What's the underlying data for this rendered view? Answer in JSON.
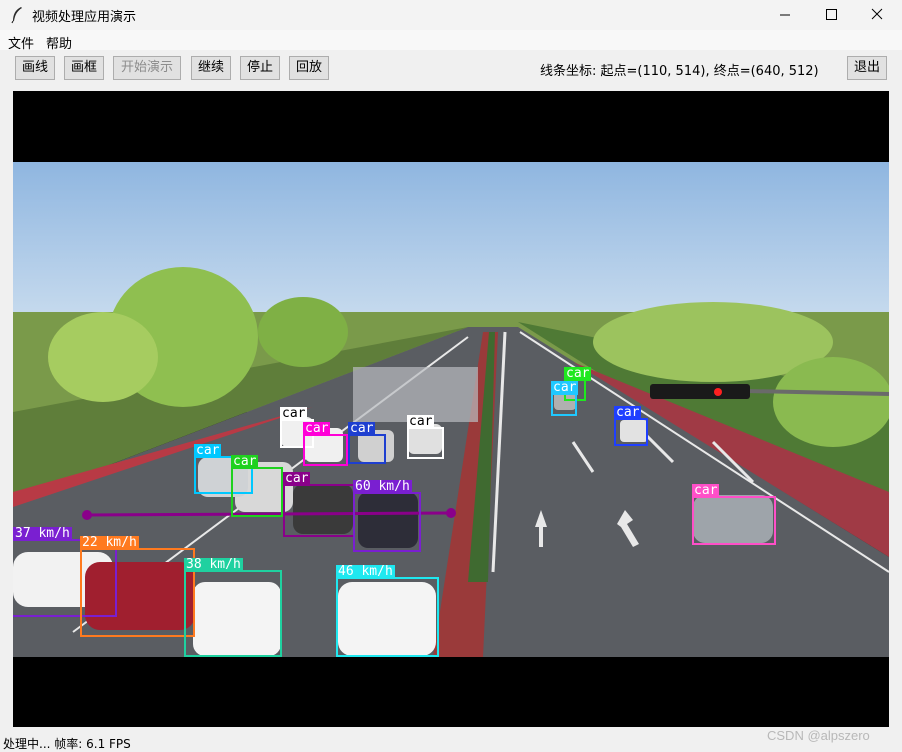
{
  "window": {
    "title": "视频处理应用演示"
  },
  "menu": {
    "file": "文件",
    "help": "帮助"
  },
  "toolbar": {
    "draw_line": "画线",
    "draw_box": "画框",
    "start_demo": "开始演示",
    "continue": "继续",
    "stop": "停止",
    "replay": "回放",
    "line_coords": "线条坐标: 起点=(110, 514), 终点=(640, 512)",
    "exit": "退出"
  },
  "detections": [
    {
      "label": "car",
      "color": "#ffffff"
    },
    {
      "label": "car",
      "color": "#ff00d8"
    },
    {
      "label": "car",
      "color": "#1e3fd0"
    },
    {
      "label": "car",
      "color": "#ffffff"
    },
    {
      "label": "car",
      "color": "#00c8ff"
    },
    {
      "label": "car",
      "color": "#1fd11f"
    },
    {
      "label": "car",
      "color": "#8a008a"
    },
    {
      "label": "60 km/h",
      "color": "#7a1fd1"
    },
    {
      "label": "37 km/h",
      "color": "#7a1fd1"
    },
    {
      "label": "22 km/h",
      "color": "#ff7a1f"
    },
    {
      "label": "38 km/h",
      "color": "#1fd1a0"
    },
    {
      "label": "46 km/h",
      "color": "#1fe8f0"
    },
    {
      "label": "car",
      "color": "#1fe81f"
    },
    {
      "label": "car",
      "color": "#1fc8ff"
    },
    {
      "label": "car",
      "color": "#1f3fff"
    },
    {
      "label": "car",
      "color": "#ff4fc8"
    }
  ],
  "status": "处理中... 帧率: 6.1 FPS",
  "watermark": "CSDN @alpszero"
}
